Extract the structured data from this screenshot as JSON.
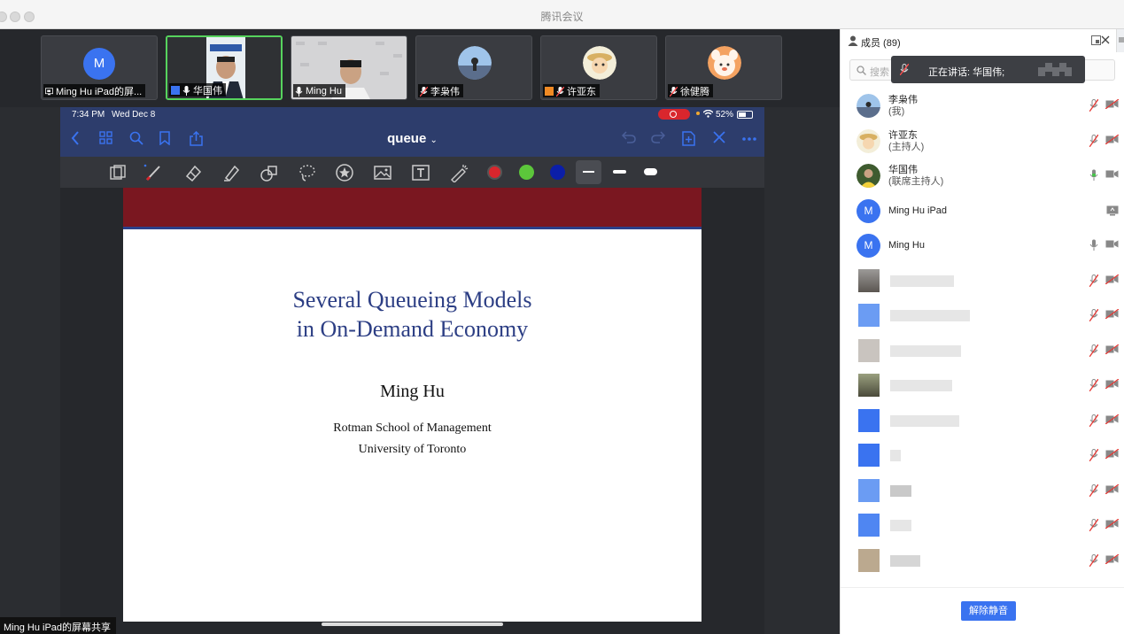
{
  "window": {
    "title": "腾讯会议"
  },
  "thumbnails": [
    {
      "name": "Ming Hu iPad的屏...",
      "avatar_letter": "M",
      "icon": "screen-share-icon",
      "active": false
    },
    {
      "name": "华国伟",
      "icon": "mic-icon",
      "active": true
    },
    {
      "name": "Ming Hu",
      "icon": "mic-icon",
      "active": false
    },
    {
      "name": "李枭伟",
      "icon": "mic-muted-icon",
      "active": false
    },
    {
      "name": "许亚东",
      "icon": "mic-muted-icon",
      "active": false
    },
    {
      "name": "徐健腾",
      "icon": "mic-muted-icon",
      "active": false
    }
  ],
  "ipad": {
    "time": "7:34 PM",
    "date": "Wed Dec 8",
    "battery": "52%",
    "doc_title": "queue",
    "doc_title_caret": "⌄"
  },
  "slide": {
    "title_line1": "Several Queueing Models",
    "title_line2": "in On-Demand Economy",
    "author": "Ming Hu",
    "affiliation_line1": "Rotman School of Management",
    "affiliation_line2": "University of Toronto"
  },
  "share_label": "Ming Hu iPad的屏幕共享",
  "panel": {
    "title": "成员 (89)",
    "search_placeholder": "搜索",
    "speaking": "正在讲话: 华国伟;",
    "unmute_button": "解除静音",
    "members": [
      {
        "name": "李枭伟",
        "role": "(我)",
        "mic": "muted",
        "cam": "off"
      },
      {
        "name": "许亚东",
        "role": "(主持人)",
        "mic": "muted",
        "cam": "off"
      },
      {
        "name": "华国伟",
        "role": "(联席主持人)",
        "mic": "on",
        "cam": "on"
      },
      {
        "name": "Ming Hu iPad",
        "role": "",
        "avatar_letter": "M",
        "mic": "screen",
        "cam": ""
      },
      {
        "name": "Ming Hu",
        "role": "",
        "avatar_letter": "M",
        "mic": "on",
        "cam": "on"
      }
    ]
  },
  "colors": {
    "accent": "#3a73f0",
    "active_border": "#56d35d",
    "ios_nav": "#2d3d6c",
    "slide_band": "#7a1720",
    "slide_title": "#2c3e84"
  }
}
